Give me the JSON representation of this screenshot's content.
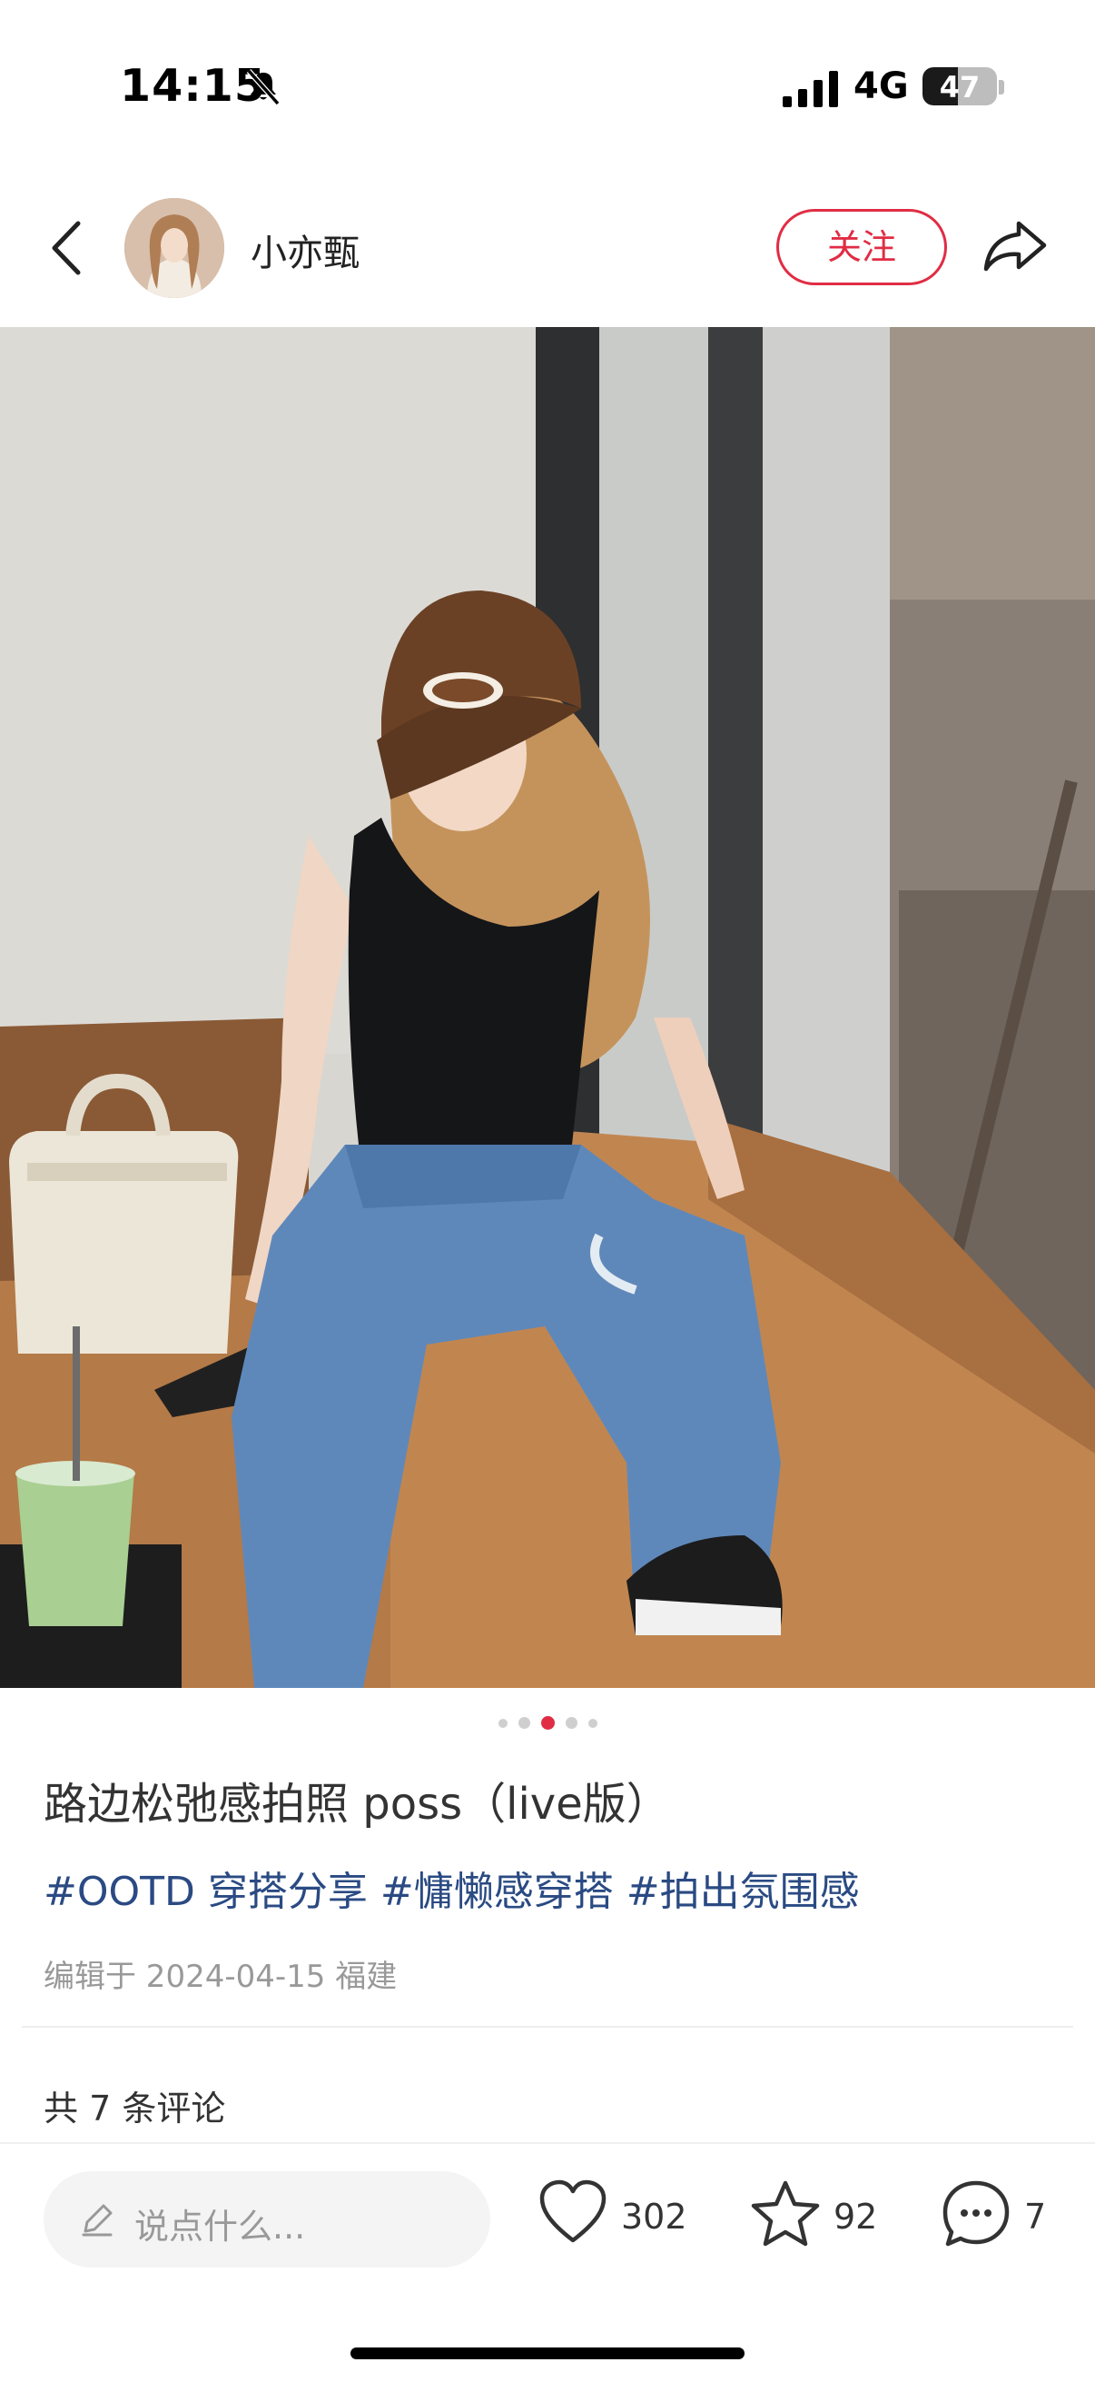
{
  "status_bar": {
    "time": "14:15",
    "network": "4G",
    "battery": "47",
    "battery_level": 0.47
  },
  "header": {
    "username": "小亦甄",
    "follow_label": "关注"
  },
  "carousel": {
    "total": 5,
    "active_index": 2
  },
  "post": {
    "title": "路边松弛感拍照 poss（live版）",
    "tags": [
      "#OOTD 穿搭分享",
      "#慵懒感穿搭",
      "#拍出氛围感"
    ],
    "meta": "编辑于 2024-04-15 福建",
    "comment_count_label": "共 7 条评论"
  },
  "bottom_bar": {
    "input_placeholder": "说点什么...",
    "likes": "302",
    "collects": "92",
    "comments": "7"
  },
  "colors": {
    "accent": "#e02d44",
    "tag": "#2a4a83"
  },
  "icons": [
    "back-icon",
    "share-icon",
    "mute-icon",
    "signal-icon",
    "pencil-icon",
    "heart-icon",
    "star-icon",
    "comment-icon"
  ]
}
